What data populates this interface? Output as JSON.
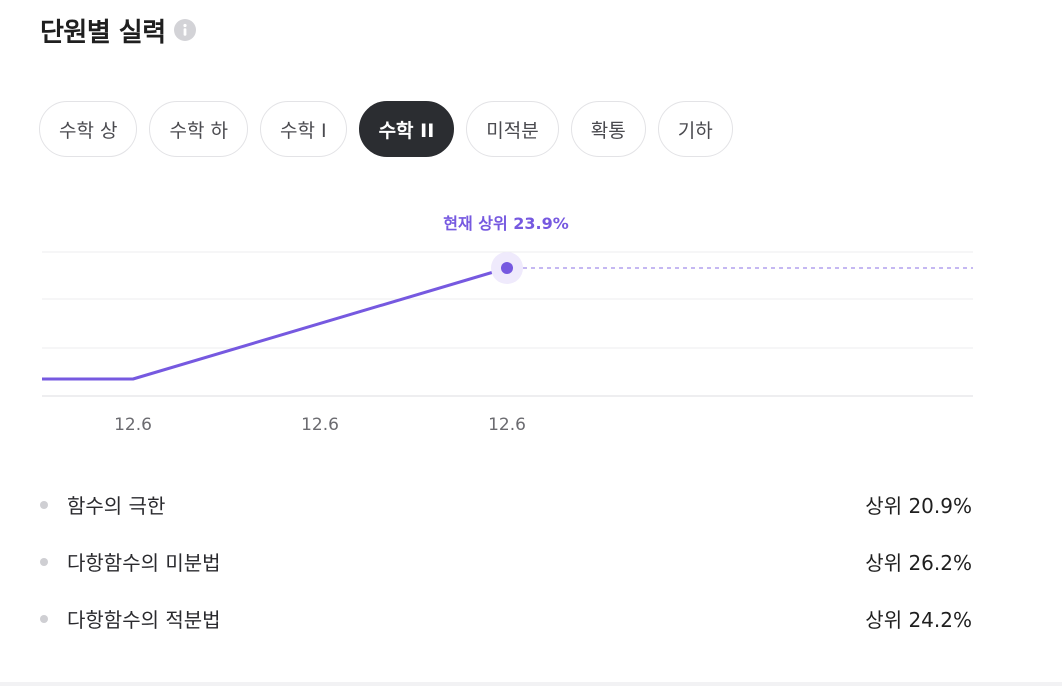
{
  "section": {
    "title": "단원별 실력",
    "info_icon": "info-circle-icon"
  },
  "tabs": [
    {
      "label": "수학 상",
      "active": false
    },
    {
      "label": "수학 하",
      "active": false
    },
    {
      "label": "수학 I",
      "active": false
    },
    {
      "label": "수학 II",
      "active": true
    },
    {
      "label": "미적분",
      "active": false
    },
    {
      "label": "확통",
      "active": false
    },
    {
      "label": "기하",
      "active": false
    }
  ],
  "chart": {
    "current_label": "현재 상위 23.9%",
    "accent_color": "#7659e0",
    "gridline_color": "#ececef",
    "x_labels": [
      "12.6",
      "12.6",
      "12.6"
    ]
  },
  "units": [
    {
      "name": "함수의 극한",
      "rank": "상위 20.9%"
    },
    {
      "name": "다항함수의 미분법",
      "rank": "상위 26.2%"
    },
    {
      "name": "다항함수의 적분법",
      "rank": "상위 24.2%"
    }
  ]
}
